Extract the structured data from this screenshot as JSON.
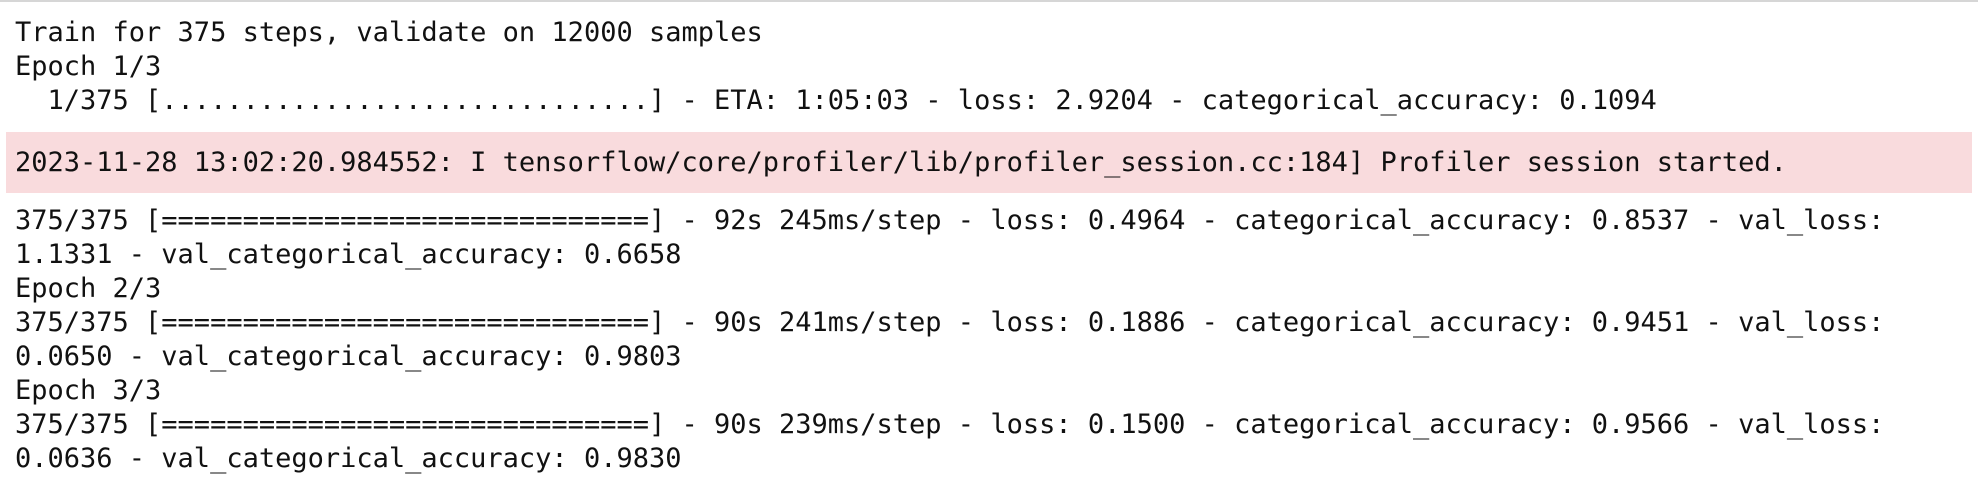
{
  "output_cell": {
    "stdout_before": [
      "Train for 375 steps, validate on 12000 samples",
      "Epoch 1/3",
      "  1/375 [..............................] - ETA: 1:05:03 - loss: 2.9204 - categorical_accuracy: 0.1094"
    ],
    "stderr": "2023-11-28 13:02:20.984552: I tensorflow/core/profiler/lib/profiler_session.cc:184] Profiler session started.",
    "stdout_after": [
      "375/375 [==============================] - 92s 245ms/step - loss: 0.4964 - categorical_accuracy: 0.8537 - val_loss:",
      "1.1331 - val_categorical_accuracy: 0.6658",
      "Epoch 2/3",
      "375/375 [==============================] - 90s 241ms/step - loss: 0.1886 - categorical_accuracy: 0.9451 - val_loss:",
      "0.0650 - val_categorical_accuracy: 0.9803",
      "Epoch 3/3",
      "375/375 [==============================] - 90s 239ms/step - loss: 0.1500 - categorical_accuracy: 0.9566 - val_loss:",
      "0.0636 - val_categorical_accuracy: 0.9830"
    ]
  },
  "colors": {
    "stderr_background": "#f9dbdd",
    "text": "#111111",
    "top_border": "#d6d6d6"
  }
}
